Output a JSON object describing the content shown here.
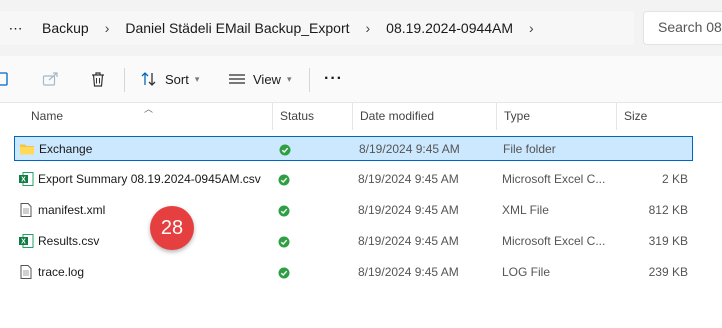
{
  "address": {
    "crumbs": [
      "Backup",
      "Daniel Städeli EMail Backup_Export",
      "08.19.2024-0944AM"
    ],
    "search_placeholder": "Search 08."
  },
  "toolbar": {
    "sort_label": "Sort",
    "view_label": "View"
  },
  "columns": [
    "Name",
    "Status",
    "Date modified",
    "Type",
    "Size"
  ],
  "files": [
    {
      "name": "Exchange",
      "date": "8/19/2024 9:45 AM",
      "type": "File folder",
      "size": "",
      "icon": "folder-icon"
    },
    {
      "name": "Export Summary 08.19.2024-0945AM.csv",
      "date": "8/19/2024 9:45 AM",
      "type": "Microsoft Excel C...",
      "size": "2 KB",
      "icon": "excel-icon"
    },
    {
      "name": "manifest.xml",
      "date": "8/19/2024 9:45 AM",
      "type": "XML File",
      "size": "812 KB",
      "icon": "document-icon"
    },
    {
      "name": "Results.csv",
      "date": "8/19/2024 9:45 AM",
      "type": "Microsoft Excel C...",
      "size": "319 KB",
      "icon": "excel-icon"
    },
    {
      "name": "trace.log",
      "date": "8/19/2024 9:45 AM",
      "type": "LOG File",
      "size": "239 KB",
      "icon": "document-icon"
    }
  ],
  "badge": "28"
}
